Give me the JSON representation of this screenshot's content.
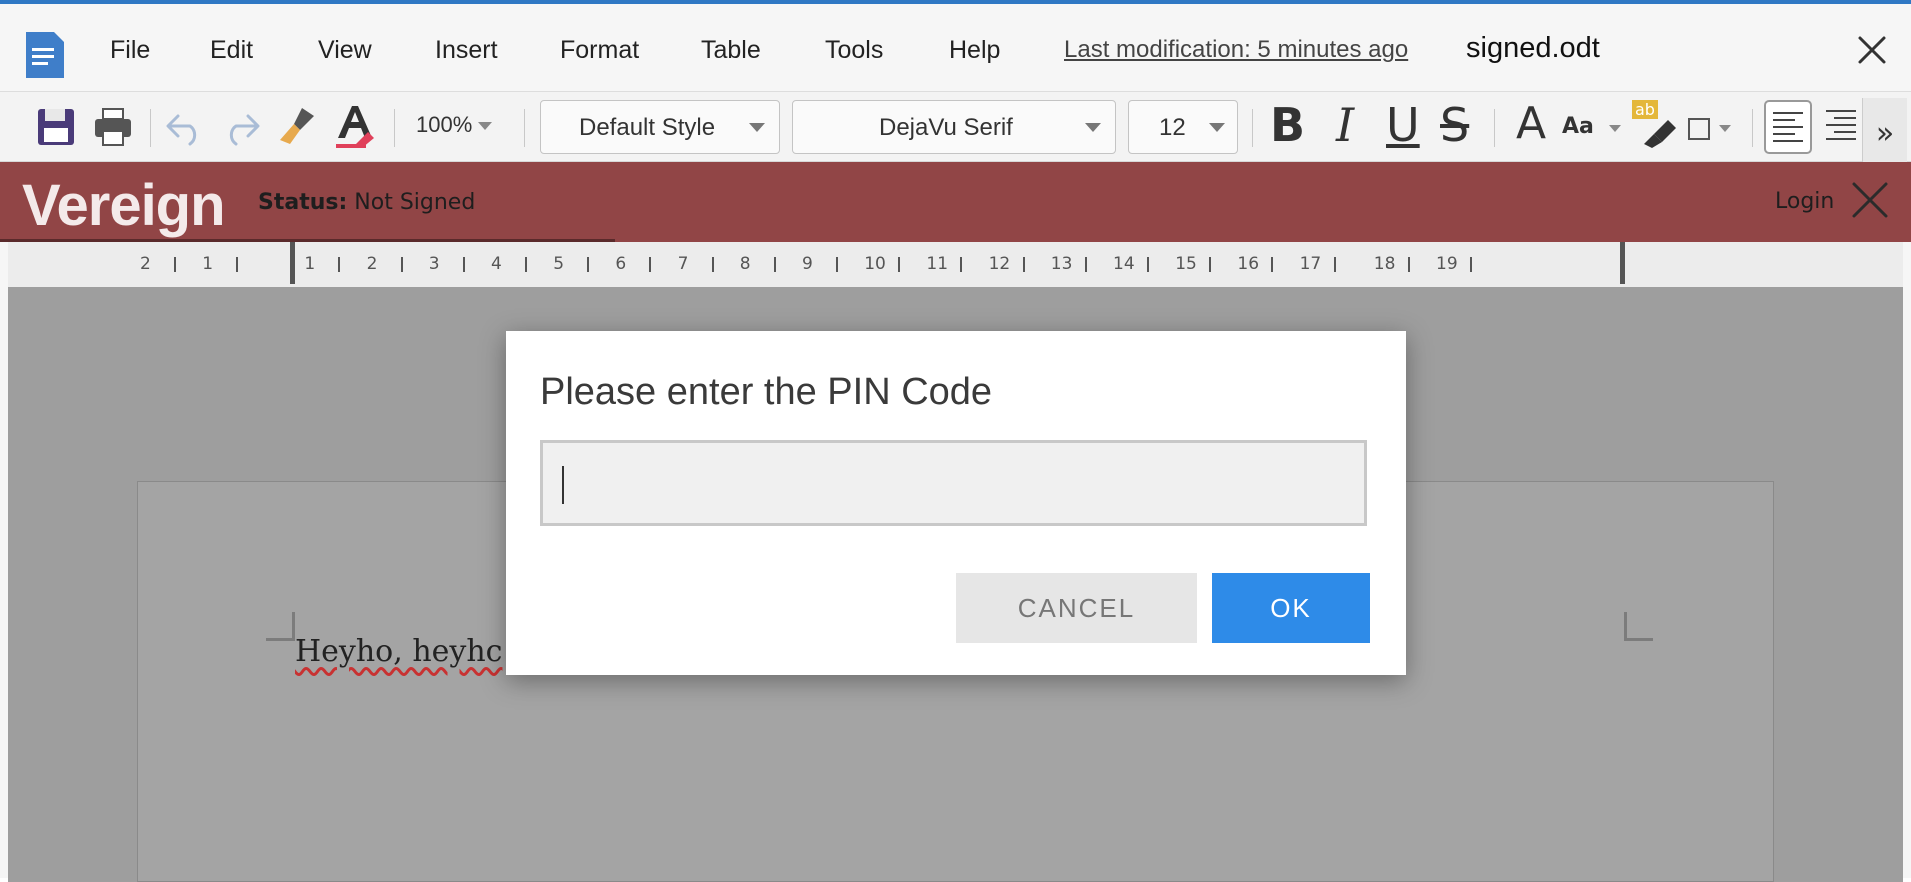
{
  "menubar": {
    "items": [
      "File",
      "Edit",
      "View",
      "Insert",
      "Format",
      "Table",
      "Tools",
      "Help"
    ],
    "last_modification": "Last modification: 5 minutes ago",
    "document_name": "signed.odt"
  },
  "toolbar": {
    "zoom": "100%",
    "paragraph_style": "Default Style",
    "font_name": "DejaVu Serif",
    "font_size": "12",
    "bold": "B",
    "italic": "I",
    "underline": "U",
    "strikethrough": "S",
    "grow_font": "A",
    "font_case": "Aa",
    "highlight_badge": "ab",
    "more": "»"
  },
  "vereign": {
    "logo": "Vereign",
    "status_label": "Status:",
    "status_value": "Not Signed",
    "login": "Login"
  },
  "ruler": {
    "numbers": [
      "2",
      "1",
      "1",
      "2",
      "3",
      "4",
      "5",
      "6",
      "7",
      "8",
      "9",
      "10",
      "11",
      "12",
      "13",
      "14",
      "15",
      "16",
      "17",
      "18",
      "19"
    ]
  },
  "document": {
    "visible_text": "Heyho, heyhc"
  },
  "dialog": {
    "title": "Please enter the PIN Code",
    "pin_value": "",
    "cancel_label": "CANCEL",
    "ok_label": "OK"
  },
  "colors": {
    "vereign_bar": "#914546",
    "ok_button": "#2e8be8",
    "accent_top": "#2f78c4"
  }
}
